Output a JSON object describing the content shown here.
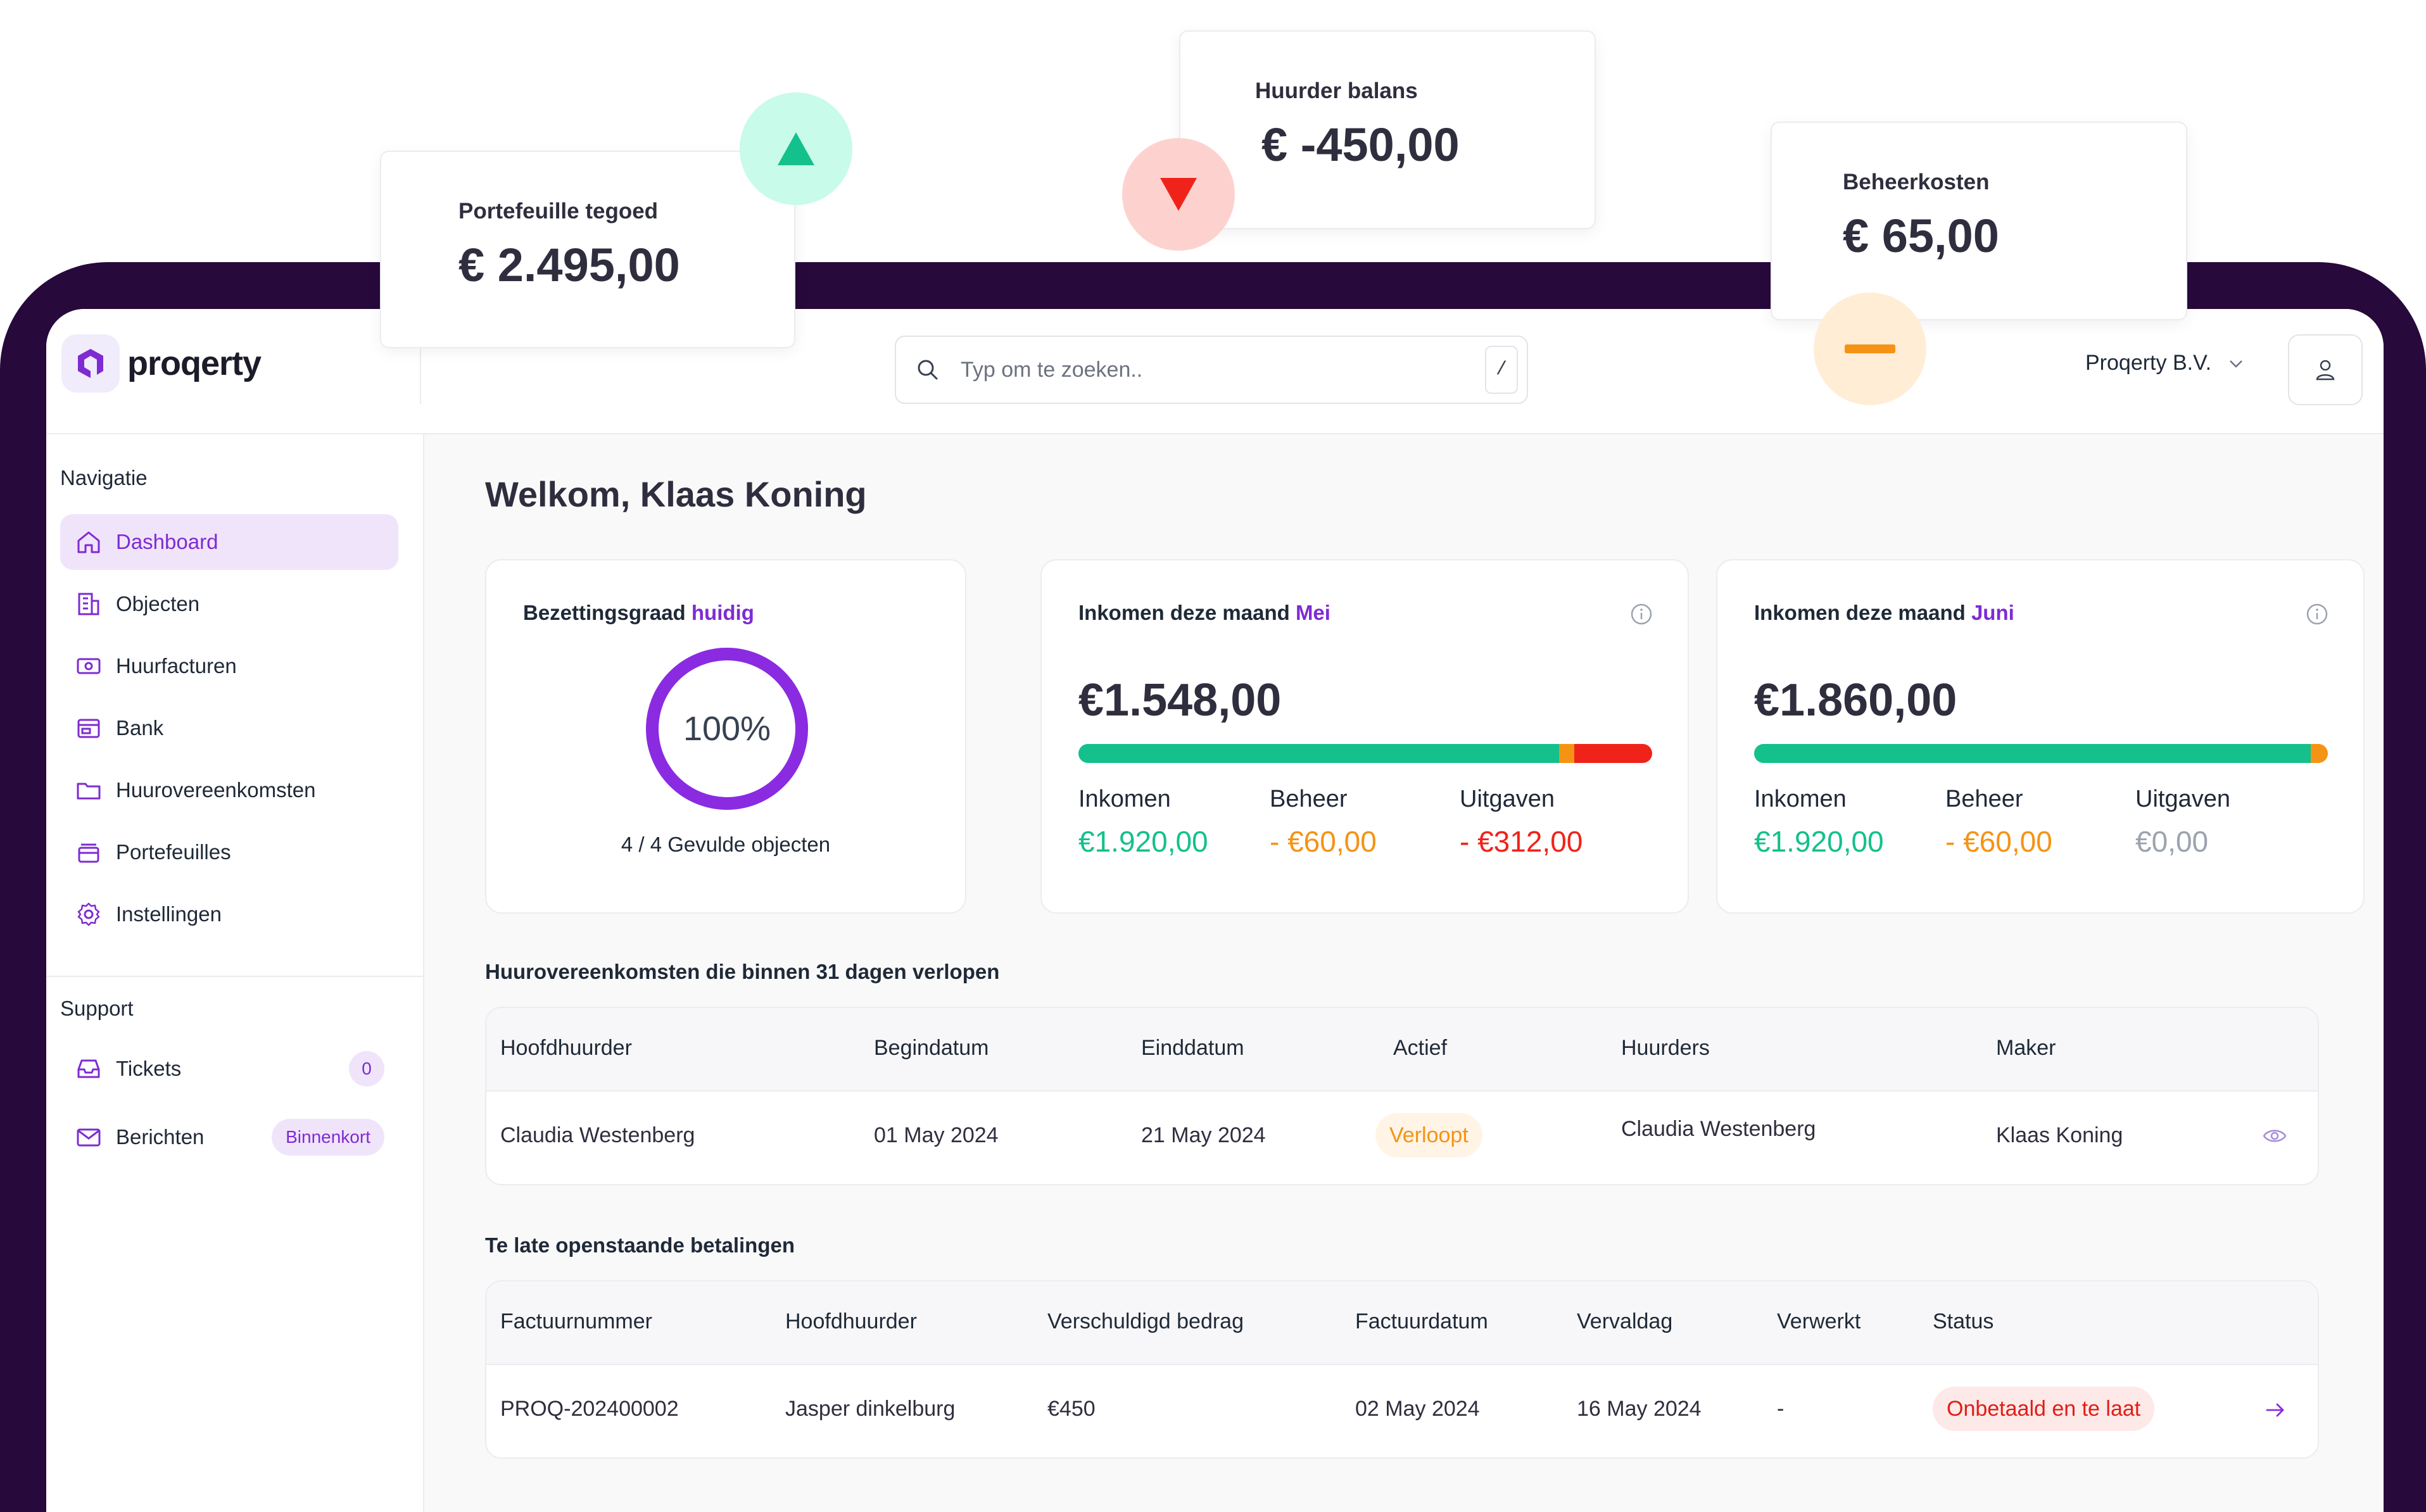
{
  "floating_cards": {
    "portfolio": {
      "label": "Portefeuille tegoed",
      "value": "€ 2.495,00"
    },
    "tenant_balance": {
      "label": "Huurder balans",
      "value": "€ -450,00"
    },
    "management": {
      "label": "Beheerkosten",
      "value": "€ 65,00"
    }
  },
  "header": {
    "logo_text": "proqerty",
    "search_placeholder": "Typ om te zoeken..",
    "search_shortcut": "/",
    "org_name": "Proqerty B.V."
  },
  "sidebar": {
    "nav_title": "Navigatie",
    "items": [
      {
        "label": "Dashboard",
        "icon": "home-icon"
      },
      {
        "label": "Objecten",
        "icon": "building-icon"
      },
      {
        "label": "Huurfacturen",
        "icon": "money-icon"
      },
      {
        "label": "Bank",
        "icon": "bank-icon"
      },
      {
        "label": "Huurovereenkomsten",
        "icon": "folder-icon"
      },
      {
        "label": "Portefeuilles",
        "icon": "wallet-icon"
      },
      {
        "label": "Instellingen",
        "icon": "gear-icon"
      }
    ],
    "support_title": "Support",
    "support_items": [
      {
        "label": "Tickets",
        "icon": "inbox-icon",
        "badge": "0"
      },
      {
        "label": "Berichten",
        "icon": "mail-icon",
        "badge": "Binnenkort"
      }
    ]
  },
  "main": {
    "welcome": "Welkom, Klaas Koning",
    "occupancy": {
      "title": "Bezettingsgraad",
      "title_accent": "huidig",
      "percent_text": "100%",
      "percent": 100,
      "subtitle": "4 / 4 Gevulde objecten"
    },
    "income_may": {
      "title": "Inkomen deze maand",
      "month": "Mei",
      "total": "€1.548,00",
      "bar": {
        "income": 1920,
        "beheer": 60,
        "uitgaven": 312
      },
      "labels": {
        "income": "Inkomen",
        "beheer": "Beheer",
        "uitgaven": "Uitgaven"
      },
      "values": {
        "income": "€1.920,00",
        "beheer": "- €60,00",
        "uitgaven": "- €312,00"
      }
    },
    "income_june": {
      "title": "Inkomen deze maand",
      "month": "Juni",
      "total": "€1.860,00",
      "bar": {
        "income": 1920,
        "beheer": 60,
        "uitgaven": 0
      },
      "labels": {
        "income": "Inkomen",
        "beheer": "Beheer",
        "uitgaven": "Uitgaven"
      },
      "values": {
        "income": "€1.920,00",
        "beheer": "- €60,00",
        "uitgaven": "€0,00"
      }
    },
    "expiring": {
      "heading": "Huurovereenkomsten die binnen 31 dagen verlopen",
      "columns": [
        "Hoofdhuurder",
        "Begindatum",
        "Einddatum",
        "Actief",
        "Huurders",
        "Maker"
      ],
      "row": {
        "hoofdhuurder": "Claudia Westenberg",
        "begindatum": "01 May 2024",
        "einddatum": "21 May 2024",
        "actief": "Verloopt",
        "huurders": "Claudia Westenberg",
        "maker": "Klaas Koning"
      }
    },
    "payments": {
      "heading": "Te late openstaande betalingen",
      "columns": [
        "Factuurnummer",
        "Hoofdhuurder",
        "Verschuldigd bedrag",
        "Factuurdatum",
        "Vervaldag",
        "Verwerkt",
        "Status"
      ],
      "row": {
        "factuurnummer": "PROQ-202400002",
        "hoofdhuurder": "Jasper dinkelburg",
        "bedrag": "€450",
        "factuurdatum": "02 May 2024",
        "vervaldag": "16 May 2024",
        "verwerkt": "-",
        "status": "Onbetaald en te laat"
      }
    }
  },
  "colors": {
    "accent": "#7e2bd3",
    "frame": "#27093b",
    "income": "#14c08b",
    "beheer": "#f59315",
    "uitgaven": "#f0231a"
  }
}
